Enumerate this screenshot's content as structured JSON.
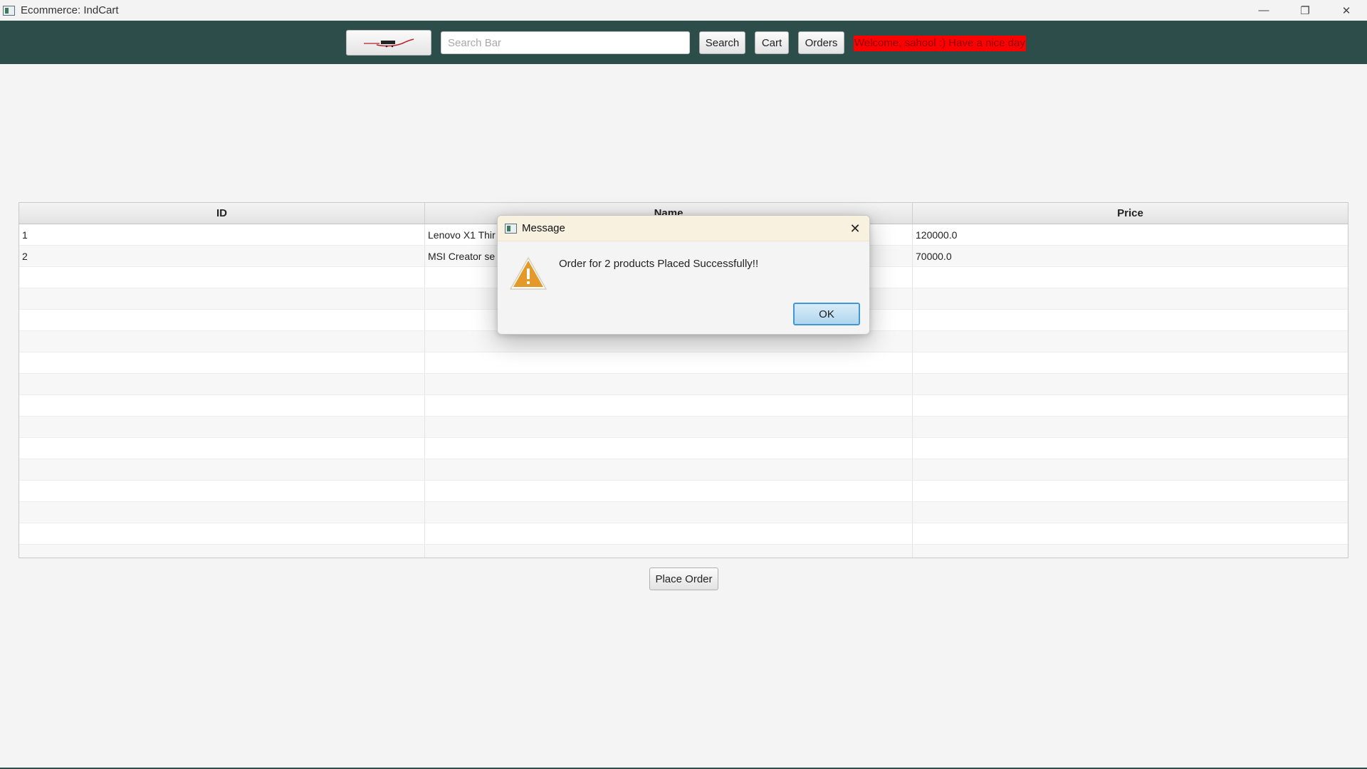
{
  "window": {
    "title": "Ecommerce: IndCart",
    "minimize_glyph": "—",
    "restore_glyph": "❐",
    "close_glyph": "✕"
  },
  "toolbar": {
    "logo_icon": "indcart-logo",
    "search_placeholder": "Search Bar",
    "search_value": "",
    "search_label": "Search",
    "cart_label": "Cart",
    "orders_label": "Orders",
    "welcome_text": "Welcome, sahool :) Have a nice day",
    "welcome_bg": "#ff0000",
    "toolbar_bg": "#2c4d4a"
  },
  "table": {
    "columns": [
      "ID",
      "Name",
      "Price"
    ],
    "rows": [
      [
        "1",
        "Lenovo X1 Thir",
        "120000.0"
      ],
      [
        "2",
        "MSI Creator se",
        "70000.0"
      ]
    ]
  },
  "place_order_label": "Place Order",
  "dialog": {
    "title": "Message",
    "close_glyph": "✕",
    "icon": "warning-icon",
    "message": "Order for 2 products Placed Successfully!!",
    "ok_label": "OK"
  }
}
